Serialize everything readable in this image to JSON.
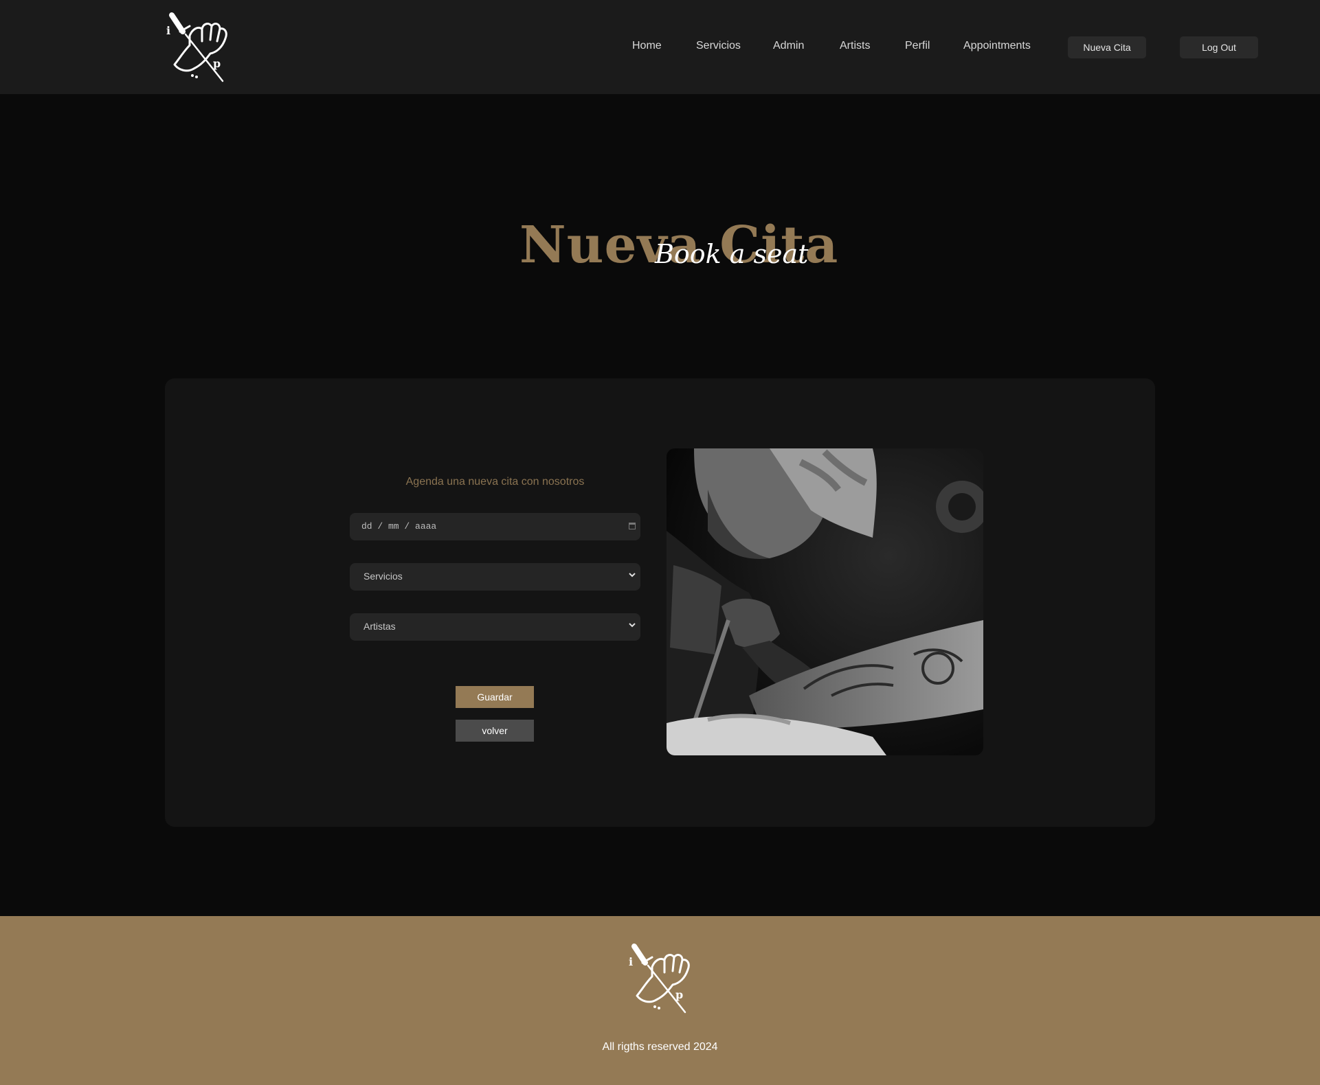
{
  "header": {
    "nav": [
      "Home",
      "Servicios",
      "Admin",
      "Artists",
      "Perfil",
      "Appointments"
    ],
    "new_appointment_button": "Nueva Cita",
    "logout_button": "Log Out"
  },
  "logo": {
    "letter_top": "i",
    "letter_bottom": "p"
  },
  "hero": {
    "title": "Nueva Cita",
    "subtitle": "Book a seat"
  },
  "form": {
    "subtitle": "Agenda una nueva cita con nosotros",
    "date_placeholder": "dd / mm / aaaa",
    "service_select": "Servicios",
    "artist_select": "Artistas",
    "save_button": "Guardar",
    "back_button": "volver"
  },
  "footer": {
    "text": "All rigths reserved 2024"
  },
  "colors": {
    "accent": "#947a55",
    "header_bg": "#1b1b1b",
    "page_bg": "#0a0a0a",
    "card_bg": "#141414"
  },
  "icons": [
    "dagger-hand-logo-icon",
    "calendar-icon",
    "chevron-down-icon"
  ]
}
